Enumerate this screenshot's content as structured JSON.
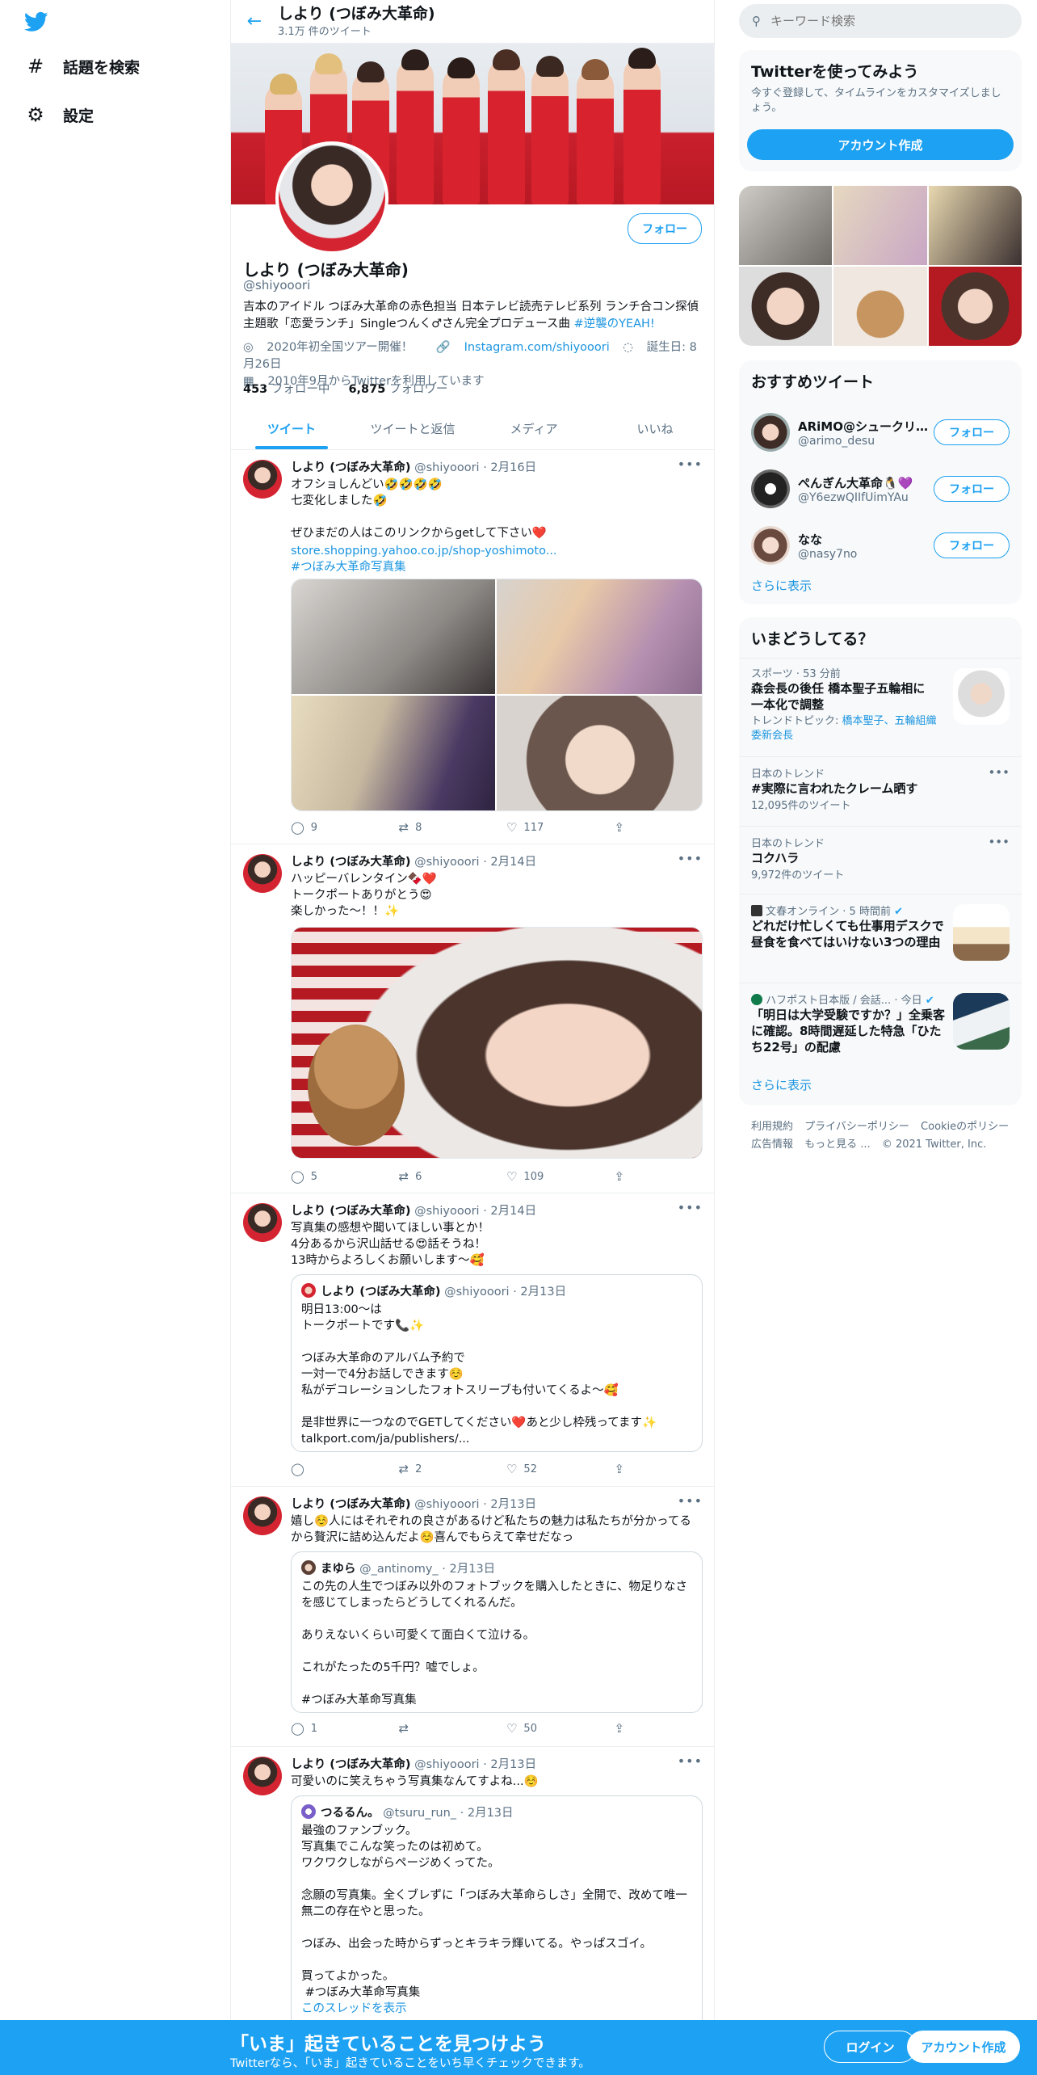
{
  "nav": {
    "explore_label": "話題を検索",
    "settings_label": "設定"
  },
  "header": {
    "name": "しより (つぼみ大革命)",
    "tweet_count": "3.1万 件のツイート"
  },
  "profile": {
    "name": "しより (つぼみ大革命)",
    "handle": "@shiyooori",
    "follow_label": "フォロー",
    "bio": "吉本のアイドル つぼみ大革命の赤色担当 日本テレビ読売テレビ系列 ランチ合コン探偵 主題歌「恋愛ランチ」Singleつんく♂さん完全プロデュース曲 ",
    "bio_link": "#逆襲のYEAH!",
    "location": "2020年初全国ツアー開催！",
    "website": "Instagram.com/shiyooori",
    "birthday": "誕生日: 8月26日",
    "joined": "2010年9月からTwitterを利用しています",
    "following_count": "453",
    "following_label": "フォロー中",
    "followers_count": "6,875",
    "followers_label": "フォロワー"
  },
  "tabs": [
    "ツイート",
    "ツイートと返信",
    "メディア",
    "いいね"
  ],
  "tweets": [
    {
      "name": "しより (つぼみ大革命)",
      "meta": "@shiyooori · 2月16日",
      "text": "オフショしんどい🤣🤣🤣🤣\n七変化しました🤣\n\nぜひまだの人はこのリンクからgetして下さい❤️",
      "link1": "store.shopping.yahoo.co.jp/shop-yoshimoto...",
      "link2": "#つぼみ大革命写真集",
      "replies": "9",
      "retweets": "8",
      "likes": "117"
    },
    {
      "name": "しより (つぼみ大革命)",
      "meta": "@shiyooori · 2月14日",
      "text": "ハッピーバレンタイン🍫❤️\nトークポートありがとう😍\n楽しかった〜！！✨",
      "replies": "5",
      "retweets": "6",
      "likes": "109"
    },
    {
      "name": "しより (つぼみ大革命)",
      "meta": "@shiyooori · 2月14日",
      "text": "写真集の感想や聞いてほしい事とか！\n4分あるから沢山話せる😍話そうね！\n13時からよろしくお願いします〜🥰",
      "quote_name": "しより (つぼみ大革命)",
      "quote_meta": "@shiyooori · 2月13日",
      "quote_text": "明日13:00〜は\nトークポートです📞✨\n\nつぼみ大革命のアルバム予約で\n一対一で4分お話しできます☺️\n私がデコレーションしたフォトスリーブも付いてくるよ〜🥰\n\n是非世界に一つなのでGETしてください❤️あと少し枠残ってます✨\ntalkport.com/ja/publishers/...",
      "replies": "",
      "retweets": "2",
      "likes": "52"
    },
    {
      "name": "しより (つぼみ大革命)",
      "meta": "@shiyooori · 2月13日",
      "text": "嬉し☺️人にはそれぞれの良さがあるけど私たちの魅力は私たちが分かってるから贅沢に詰め込んだよ☺️喜んでもらえて幸せだなっ",
      "quote_name": "まゆら",
      "quote_meta": "@_antinomy_ · 2月13日",
      "quote_text": "この先の人生でつぼみ以外のフォトブックを購入したときに、物足りなさを感じてしまったらどうしてくれるんだ。\n\nありえないくらい可愛くて面白くて泣ける。\n\nこれがたったの5千円？嘘でしょ。\n\n#つぼみ大革命写真集",
      "replies": "1",
      "retweets": "",
      "likes": "50"
    },
    {
      "name": "しより (つぼみ大革命)",
      "meta": "@shiyooori · 2月13日",
      "text": "可愛いのに笑えちゃう写真集なんてすよね...☺️",
      "quote_name": "つるるん。",
      "quote_meta": "@tsuru_run_ · 2月13日",
      "quote_text": "最強のファンブック。\n写真集でこんな笑ったのは初めて。\nワクワクしながらページめくってた。\n\n念願の写真集。全くブレずに「つぼみ大革命らしさ」全開で、改めて唯一無二の存在やと思った。\n\nつぼみ、出会った時からずっとキラキラ輝いてる。やっぱスゴイ。\n\n買ってよかった。\n #つぼみ大革命写真集",
      "quote_more": "このスレッドを表示"
    }
  ],
  "sidebar": {
    "search_placeholder": "キーワード検索",
    "signup_title": "Twitterを使ってみよう",
    "signup_desc": "今すぐ登録して、タイムラインをカスタマイズしましょう。",
    "signup_button": "アカウント作成",
    "rec_title": "おすすめツイート",
    "recs": [
      {
        "name": "ARiMO@シュークリーム...",
        "handle": "@arimo_desu",
        "follow": "フォロー"
      },
      {
        "name": "ぺんぎん大革命🐧💜",
        "handle": "@Y6ezwQIIfUimYAu",
        "follow": "フォロー"
      },
      {
        "name": "なな",
        "handle": "@nasy7no",
        "follow": "フォロー"
      }
    ],
    "rec_more": "さらに表示",
    "trends_title": "いまどうしてる？",
    "trends": [
      {
        "context": "スポーツ · 53 分前",
        "title": "森会長の後任 橋本聖子五輪相に一本化で調整",
        "sub": "トレンドトピック: ",
        "sub_links": "橋本聖子、五輪組織委新会長"
      },
      {
        "context": "日本のトレンド",
        "title": "#実際に言われたクレーム晒す",
        "sub": "12,095件のツイート"
      },
      {
        "context": "日本のトレンド",
        "title": "コクハラ",
        "sub": "9,972件のツイート"
      },
      {
        "context": "文春オンライン · 5 時間前",
        "title": "どれだけ忙しくても仕事用デスクで昼食を食べてはいけない3つの理由"
      },
      {
        "context": "ハフポスト日本版 / 会話... · 今日",
        "title": "「明日は大学受験ですか？」全乗客に確認。8時間遅延した特急「ひたち22号」の配慮"
      }
    ],
    "trends_more": "さらに表示",
    "footer": [
      "利用規約",
      "プライバシーポリシー",
      "Cookieのポリシー",
      "広告情報",
      "もっと見る ...",
      "© 2021 Twitter, Inc."
    ]
  },
  "bottom_bar": {
    "title": "「いま」起きていることを見つけよう",
    "subtitle": "Twitterなら、「いま」起きていることをいち早くチェックできます。",
    "login": "ログイン",
    "signup": "アカウント作成"
  },
  "colors": {
    "accent": "#1da1f2",
    "link": "#1b95e0",
    "secondary_text": "#5b7083"
  },
  "icons": [
    "twitter-logo-icon",
    "hashtag-icon",
    "gear-icon",
    "back-arrow-icon",
    "search-icon",
    "location-icon",
    "link-icon",
    "balloon-icon",
    "calendar-icon",
    "reply-icon",
    "retweet-icon",
    "like-icon",
    "share-icon",
    "more-icon",
    "verified-icon"
  ]
}
